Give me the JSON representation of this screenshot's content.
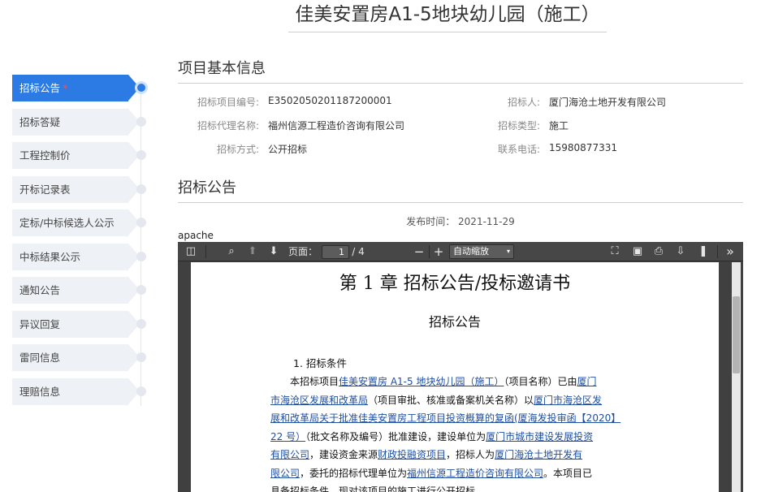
{
  "page": {
    "title": "佳美安置房A1-5地块幼儿园（施工）"
  },
  "sidebar": {
    "items": [
      {
        "label": "招标公告",
        "active": true,
        "required_mark": "*"
      },
      {
        "label": "招标答疑"
      },
      {
        "label": "工程控制价"
      },
      {
        "label": "开标记录表"
      },
      {
        "label": "定标/中标候选人公示"
      },
      {
        "label": "中标结果公示"
      },
      {
        "label": "通知公告"
      },
      {
        "label": "异议回复"
      },
      {
        "label": "雷同信息"
      },
      {
        "label": "理赔信息"
      }
    ]
  },
  "basic_info": {
    "title": "项目基本信息",
    "rows": [
      {
        "label1": "招标项目编号:",
        "value1": "E3502050201187200001",
        "label2": "招标人:",
        "value2": "厦门海沧土地开发有限公司"
      },
      {
        "label1": "招标代理名称:",
        "value1": "福州信源工程造价咨询有限公司",
        "label2": "招标类型:",
        "value2": "施工"
      },
      {
        "label1": "招标方式:",
        "value1": "公开招标",
        "label2": "联系电话:",
        "value2": "15980877331"
      }
    ]
  },
  "notice": {
    "title": "招标公告",
    "publish_time": "发布时间： 2021-11-29",
    "server_text": "apache"
  },
  "pdf_viewer": {
    "toolbar": {
      "page_label": "页面：",
      "page_current": "1",
      "page_total": "/ 4",
      "zoom_minus": "−",
      "zoom_plus": "+",
      "zoom_value": "自动缩放",
      "more": "»"
    },
    "document": {
      "chapter_title": "第  1  章  招标公告/投标邀请书",
      "subtitle": "招标公告",
      "section_heading": "1.  招标条件",
      "lines": [
        [
          {
            "t": "本招标项目"
          },
          {
            "t": "佳美安置房 A1-5 地块幼儿园（施工）",
            "u": true
          },
          {
            "t": "（项目名称）已由"
          },
          {
            "t": "厦门",
            "u": true
          }
        ],
        [
          {
            "t": "市海沧区发展和改革局",
            "u": true
          },
          {
            "t": "（项目审批、核准或备案机关名称）以"
          },
          {
            "t": "厦门市海沧区发",
            "u": true
          }
        ],
        [
          {
            "t": "展和改革局关于批准佳美安置房工程项目投资概算的复函(厦海发投审函【2020】",
            "u": true
          }
        ],
        [
          {
            "t": "22 号）",
            "u": true
          },
          {
            "t": "（批文名称及编号）批准建设，建设单位为"
          },
          {
            "t": "厦门市城市建设发展投资",
            "u": true
          }
        ],
        [
          {
            "t": "有限公司",
            "u": true
          },
          {
            "t": "，建设资金来源"
          },
          {
            "t": "财政投融资项目",
            "u": true
          },
          {
            "t": "，招标人为"
          },
          {
            "t": "厦门海沧土地开发有",
            "u": true
          }
        ],
        [
          {
            "t": "限公司",
            "u": true
          },
          {
            "t": "，委托的招标代理单位为"
          },
          {
            "t": "福州信源工程造价咨询有限公司",
            "u": true
          },
          {
            "t": "。本项目已"
          }
        ],
        [
          {
            "t": "具备招标条件，现对该项目的施工进行公开招标。"
          }
        ]
      ]
    }
  }
}
